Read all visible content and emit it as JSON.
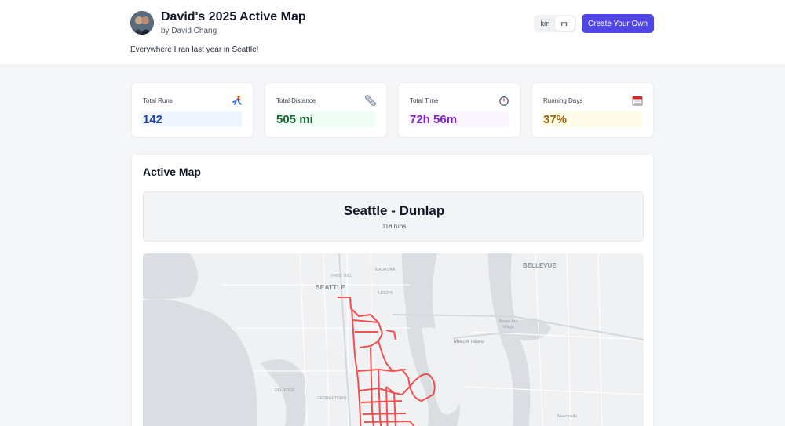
{
  "header": {
    "title": "David's 2025 Active Map",
    "byline": "by David Chang",
    "description": "Everywhere I ran last year in Seattle!",
    "units": [
      "km",
      "mi"
    ],
    "selected_unit": "mi",
    "create_button": "Create Your Own",
    "accent_color": "#5046e5"
  },
  "stats": [
    {
      "label": "Total Runs",
      "value": "142",
      "icon": "runner-icon",
      "color": "#1e40af",
      "bg": "#eff6ff"
    },
    {
      "label": "Total Distance",
      "value": "505 mi",
      "icon": "ruler-icon",
      "color": "#166534",
      "bg": "#f0fdf4"
    },
    {
      "label": "Total Time",
      "value": "72h 56m",
      "icon": "stopwatch-icon",
      "color": "#7e22ce",
      "bg": "#faf5ff"
    },
    {
      "label": "Running Days",
      "value": "37%",
      "icon": "calendar-icon",
      "color": "#a16207",
      "bg": "#fefce8"
    }
  ],
  "map_section": {
    "title": "Active Map",
    "region_name": "Seattle - Dunlap",
    "region_runs": "118 runs",
    "route_color": "#ef4444",
    "map_labels": {
      "bellevue": "BELLEVUE",
      "seattle": "SEATTLE",
      "first_hill": "FIRST HILL",
      "madrona": "MADRONA",
      "leschi": "LESCHI",
      "mercer_island": "Mercer Island",
      "beaux_arts": "Beaux Arts",
      "beaux_arts_2": "Village",
      "delridge": "DELRIDGE",
      "georgetown": "GEORGETOWN",
      "newcastle": "Newcastle"
    }
  }
}
